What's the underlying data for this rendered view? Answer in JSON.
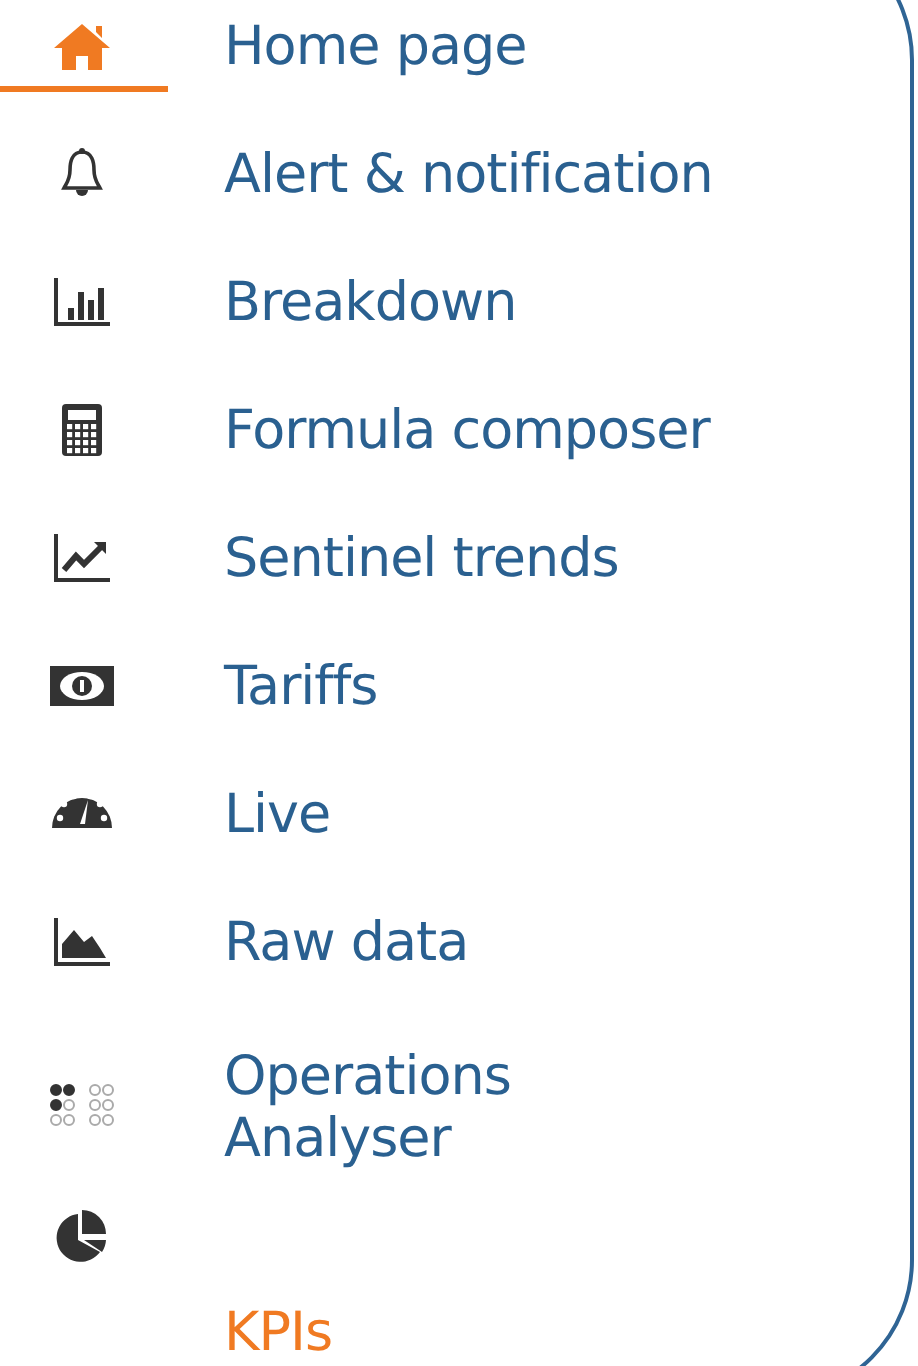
{
  "menu": {
    "items": [
      {
        "kind": "home",
        "label": "Home page",
        "selected": true,
        "highlighted": false
      },
      {
        "kind": "bell",
        "label": "Alert & notification",
        "selected": false,
        "highlighted": false
      },
      {
        "kind": "bars",
        "label": "Breakdown",
        "selected": false,
        "highlighted": false
      },
      {
        "kind": "calculator",
        "label": "Formula composer",
        "selected": false,
        "highlighted": false
      },
      {
        "kind": "trend",
        "label": "Sentinel trends",
        "selected": false,
        "highlighted": false
      },
      {
        "kind": "banknote",
        "label": "Tariffs",
        "selected": false,
        "highlighted": false
      },
      {
        "kind": "gauge",
        "label": "Live",
        "selected": false,
        "highlighted": false
      },
      {
        "kind": "area",
        "label": "Raw data",
        "selected": false,
        "highlighted": false
      },
      {
        "kind": "dots",
        "label": "Operations Analyser",
        "selected": false,
        "highlighted": false
      },
      {
        "kind": "pie",
        "label": "KPIs",
        "selected": false,
        "highlighted": true
      }
    ]
  }
}
